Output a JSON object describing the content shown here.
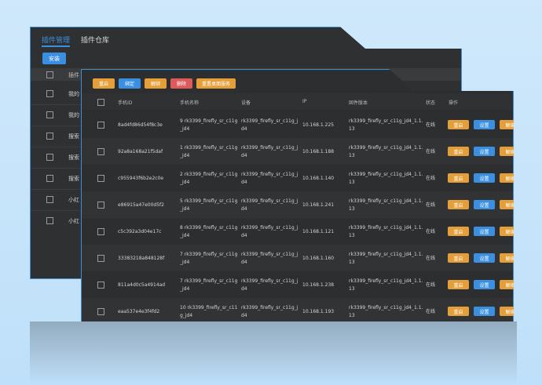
{
  "back_panel": {
    "tabs": [
      {
        "label": "插件管理",
        "active": true
      },
      {
        "label": "插件仓库",
        "active": false
      }
    ],
    "install_label": "安装",
    "header_label": "插件",
    "rows": [
      "我的",
      "我的",
      "搜索",
      "搜索",
      "搜索",
      "小红",
      "小红"
    ]
  },
  "toolbar": {
    "restart": "重启",
    "bind": "绑定",
    "unbind": "解绑",
    "delete": "删除",
    "reset_desktop": "重置桌面服务"
  },
  "columns": {
    "phone_id": "手机ID",
    "phone_name": "手机名称",
    "device": "设备",
    "ip": "IP",
    "firmware": "固件版本",
    "status": "状态",
    "actions": "操作"
  },
  "actions": {
    "restart": "重启",
    "settings": "设置",
    "unbind": "解绑"
  },
  "rows": [
    {
      "id": "8ad4fd86d54f8c3e",
      "name1": "9 rk3399_firefly_sr_c11g",
      "name2": "_jd4",
      "dev1": "rk3399_firefly_sr_c11g_j",
      "dev2": "d4",
      "ip": "10.168.1.225",
      "fw1": "rk3399_firefly_sr_c11g_jd4_1.1.",
      "fw2": "13",
      "status": "在线"
    },
    {
      "id": "92a8a168a21f5daf",
      "name1": "1 rk3399_firefly_sr_c11g",
      "name2": "_jd4",
      "dev1": "rk3399_firefly_sr_c11g_j",
      "dev2": "d4",
      "ip": "10.168.1.188",
      "fw1": "rk3399_firefly_sr_c11g_jd4_1.1.",
      "fw2": "13",
      "status": "在线"
    },
    {
      "id": "c955943f6b2e2c0e",
      "name1": "2 rk3399_firefly_sr_c11g",
      "name2": "_jd4",
      "dev1": "rk3399_firefly_sr_c11g_j",
      "dev2": "d4",
      "ip": "10.168.1.140",
      "fw1": "rk3399_firefly_sr_c11g_jd4_1.1.",
      "fw2": "13",
      "status": "在线"
    },
    {
      "id": "e86915a47e00d5f2",
      "name1": "5 rk3399_firefly_sr_c11g",
      "name2": "_jd4",
      "dev1": "rk3399_firefly_sr_c11g_j",
      "dev2": "d4",
      "ip": "10.168.1.241",
      "fw1": "rk3399_firefly_sr_c11g_jd4_1.1.",
      "fw2": "13",
      "status": "在线"
    },
    {
      "id": "c5c392a3d04e17c",
      "name1": "8 rk3399_firefly_sr_c11g",
      "name2": "_jd4",
      "dev1": "rk3399_firefly_sr_c11g_j",
      "dev2": "d4",
      "ip": "10.168.1.121",
      "fw1": "rk3399_firefly_sr_c11g_jd4_1.1.",
      "fw2": "13",
      "status": "在线"
    },
    {
      "id": "33383218a848128f",
      "name1": "7 rk3399_firefly_sr_c11g",
      "name2": "_jd4",
      "dev1": "rk3399_firefly_sr_c11g_j",
      "dev2": "d4",
      "ip": "10.168.1.160",
      "fw1": "rk3399_firefly_sr_c11g_jd4_1.1.",
      "fw2": "13",
      "status": "在线"
    },
    {
      "id": "811a4d0c5a4914ad",
      "name1": "7 rk3399_firefly_sr_c11g",
      "name2": "_jd4",
      "dev1": "rk3399_firefly_sr_c11g_j",
      "dev2": "d4",
      "ip": "10.168.1.238",
      "fw1": "rk3399_firefly_sr_c11g_jd4_1.1.",
      "fw2": "13",
      "status": "在线"
    },
    {
      "id": "eaa537e4e3f4fd2",
      "name1": "10 rk3399_firefly_sr_c11",
      "name2": "g_jd4",
      "dev1": "rk3399_firefly_sr_c11g_j",
      "dev2": "d4",
      "ip": "10.168.1.193",
      "fw1": "rk3399_firefly_sr_c11g_jd4_1.1.",
      "fw2": "13",
      "status": "在线"
    }
  ],
  "colors": {
    "accent": "#3a8fe0",
    "orange": "#e49f3a",
    "red": "#dd5a5a",
    "panel": "#2d2e2f",
    "border": "#3f8fd0"
  }
}
